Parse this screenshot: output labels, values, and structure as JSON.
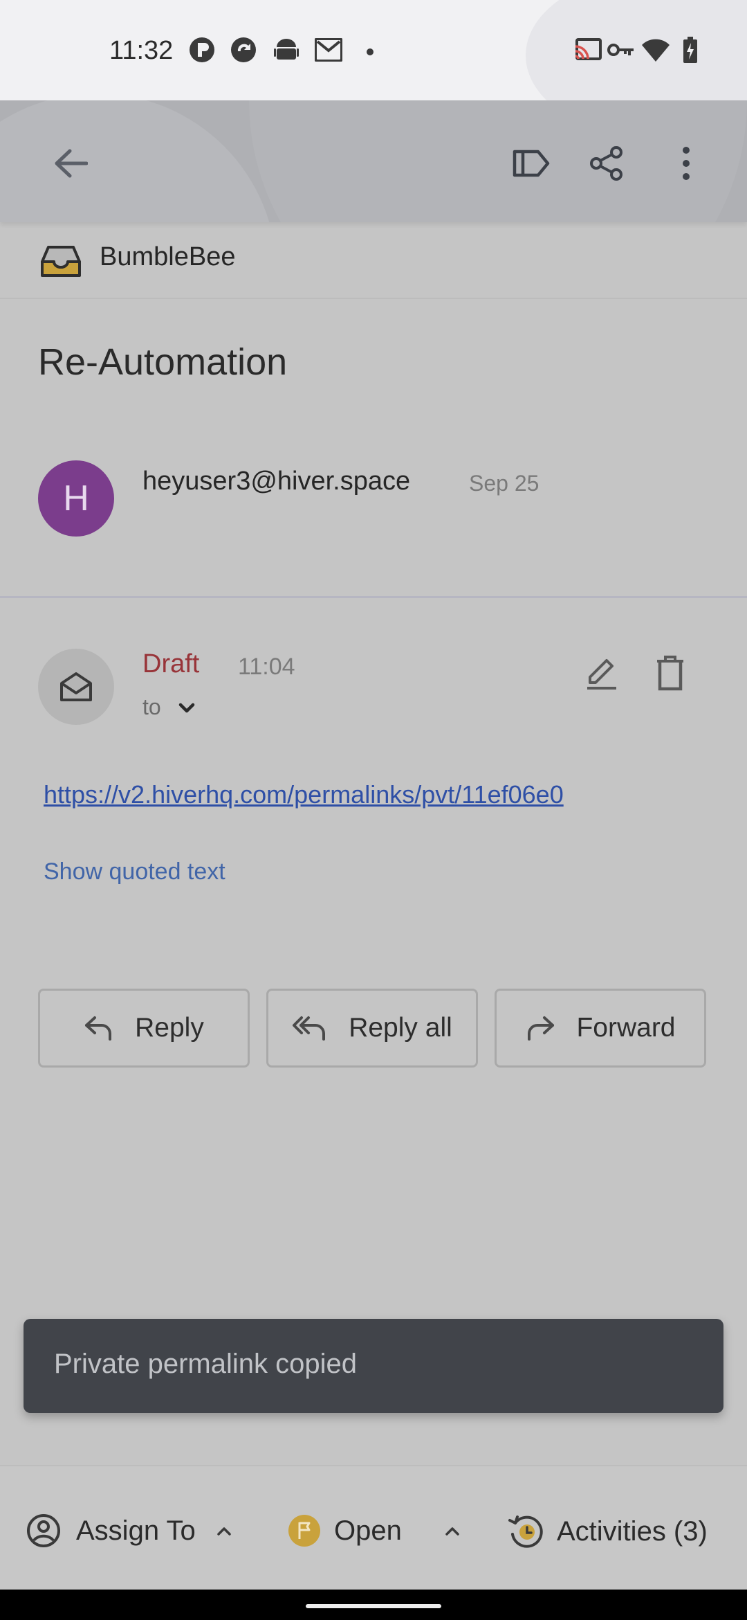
{
  "status_bar": {
    "time": "11:32"
  },
  "toolbar": {
    "back": "back",
    "label": "label",
    "share": "share",
    "more": "more"
  },
  "inbox": {
    "name": "BumbleBee",
    "icon": "inbox-tray-icon",
    "icon_color": "#c9a23c"
  },
  "thread": {
    "subject": "Re-Automation"
  },
  "message": {
    "avatar_letter": "H",
    "avatar_color": "#7b3d8c",
    "sender": "heyuser3@hiver.space",
    "date": "Sep 25"
  },
  "draft": {
    "label": "Draft",
    "time": "11:04",
    "to_label": "to",
    "link": "https://v2.hiverhq.com/permalinks/pvt/11ef06e0",
    "show_quoted": "Show quoted text"
  },
  "actions": {
    "reply": "Reply",
    "reply_all": "Reply all",
    "forward": "Forward"
  },
  "snackbar": {
    "text": "Private permalink copied"
  },
  "bottom_bar": {
    "assign": "Assign To",
    "status": "Open",
    "status_color": "#c9a23c",
    "activities": "Activities (3)"
  }
}
